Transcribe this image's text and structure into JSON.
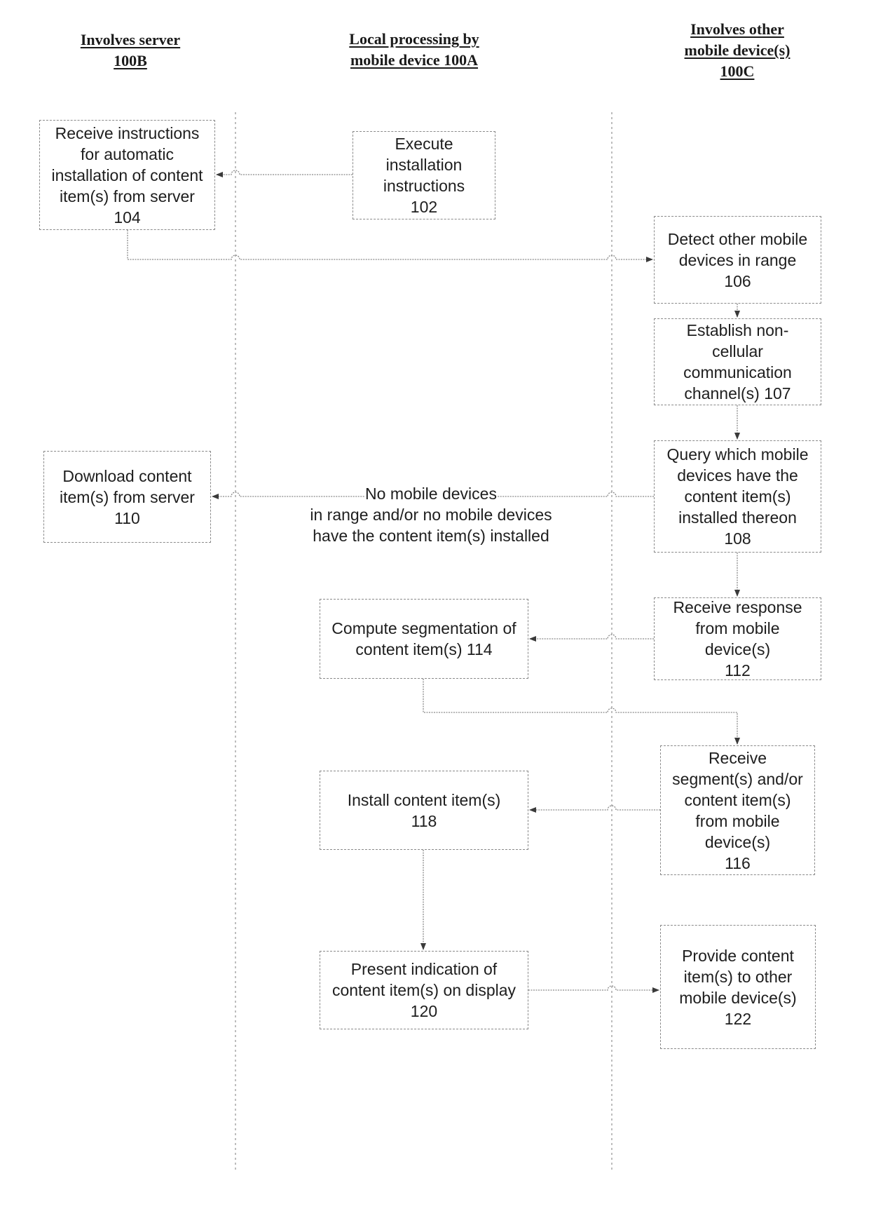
{
  "lanes": [
    {
      "id": "server",
      "header_lines": [
        "Involves server",
        "100B"
      ]
    },
    {
      "id": "local",
      "header_lines": [
        "Local processing by",
        "mobile device 100A"
      ]
    },
    {
      "id": "other",
      "header_lines": [
        "Involves other",
        "mobile device(s)",
        "100C"
      ]
    }
  ],
  "steps": {
    "s102": {
      "text": "Execute\ninstallation\ninstructions\n102",
      "lane": "local"
    },
    "s104": {
      "text": "Receive instructions\nfor automatic\ninstallation of content\nitem(s) from server\n104",
      "lane": "server"
    },
    "s106": {
      "text": "Detect other mobile\ndevices in range\n106",
      "lane": "other"
    },
    "s107": {
      "text": "Establish non-\ncellular\ncommunication\nchannel(s) 107",
      "lane": "other"
    },
    "s108": {
      "text": "Query which mobile\ndevices have the\ncontent item(s)\ninstalled thereon\n108",
      "lane": "other"
    },
    "s110": {
      "text": "Download content\nitem(s) from server\n110",
      "lane": "server"
    },
    "s112": {
      "text": "Receive response\nfrom mobile\ndevice(s)\n112",
      "lane": "other"
    },
    "s114": {
      "text": "Compute segmentation of\ncontent item(s) 114",
      "lane": "local"
    },
    "s116": {
      "text": "Receive\nsegment(s) and/or\ncontent item(s)\nfrom mobile\ndevice(s)\n116",
      "lane": "other"
    },
    "s118": {
      "text": "Install content item(s)\n118",
      "lane": "local"
    },
    "s120": {
      "text": "Present indication of\ncontent item(s) on display\n120",
      "lane": "local"
    },
    "s122": {
      "text": "Provide content\nitem(s) to other\nmobile device(s)\n122",
      "lane": "other"
    }
  },
  "edges": [
    {
      "from": "s102",
      "to": "s104"
    },
    {
      "from": "s104",
      "to": "s106"
    },
    {
      "from": "s106",
      "to": "s107"
    },
    {
      "from": "s107",
      "to": "s108"
    },
    {
      "from": "s108",
      "to": "s110",
      "label": "No mobile devices\nin range and/or no mobile devices\nhave the content item(s) installed"
    },
    {
      "from": "s108",
      "to": "s112"
    },
    {
      "from": "s112",
      "to": "s114"
    },
    {
      "from": "s114",
      "to": "s116"
    },
    {
      "from": "s116",
      "to": "s118"
    },
    {
      "from": "s118",
      "to": "s120"
    },
    {
      "from": "s120",
      "to": "s122"
    }
  ],
  "colors": {
    "line": "#8a8a8a",
    "arrow": "#3a3a3a",
    "text": "#1e1e1e"
  }
}
